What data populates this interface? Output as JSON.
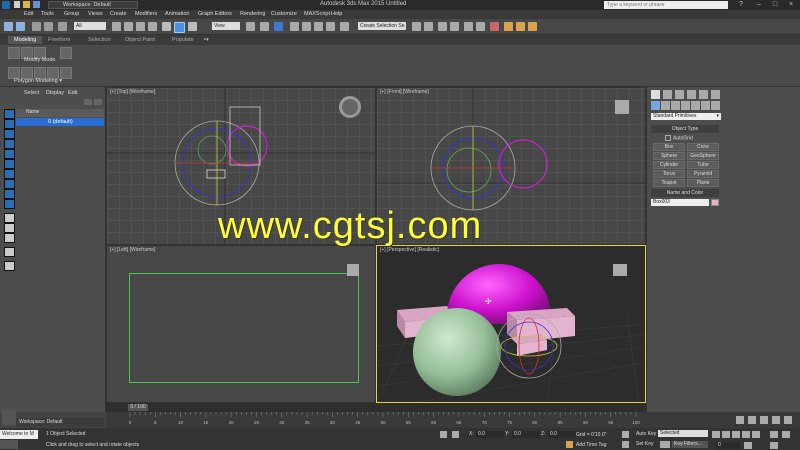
{
  "titlebar": {
    "workspace": "Workspace: Default",
    "title": "Autodesk 3ds Max 2015    Untitled",
    "search_placeholder": "Type a keyword or phrase"
  },
  "menu": [
    "Edit",
    "Tools",
    "Group",
    "Views",
    "Create",
    "Modifiers",
    "Animation",
    "Graph Editors",
    "Rendering",
    "Customize",
    "MAXScript",
    "Help"
  ],
  "toolbar": {
    "filter": "All",
    "view": "View",
    "selection_set": "Create Selection Se"
  },
  "ribbon": {
    "tabs": [
      "Modeling",
      "Freeform",
      "Selection",
      "Object Paint",
      "Populate"
    ],
    "modify_mode": "Modify Mode",
    "polygon_modeling": "Polygon Modeling"
  },
  "scene_explorer": {
    "tabs": [
      "Select",
      "Display",
      "Edit"
    ],
    "column": "Name",
    "rows": [
      "0 (default)"
    ],
    "workspace": "Workspace: Default"
  },
  "viewports": {
    "top": "[+] [Top] [Wireframe]",
    "front": "[+] [Front] [Wireframe]",
    "left": "[+] [Left] [Wireframe]",
    "perspective": "[+] [Perspective] [Realistic]"
  },
  "watermark": "www.cgtsj.com",
  "command_panel": {
    "category": "Standard Primitives",
    "object_type_header": "Object Type",
    "autogrid": "AutoGrid",
    "buttons": [
      "Box",
      "Cone",
      "Sphere",
      "GeoSphere",
      "Cylinder",
      "Tube",
      "Torus",
      "Pyramid",
      "Teapot",
      "Plane"
    ],
    "name_color_header": "Name and Color",
    "object_name": "Box003",
    "object_color": "#e8b0c8"
  },
  "timeline": {
    "slider": "0 / 100",
    "ticks": [
      "0",
      "5",
      "10",
      "15",
      "20",
      "25",
      "30",
      "35",
      "40",
      "45",
      "50",
      "55",
      "60",
      "65",
      "70",
      "75",
      "80",
      "85",
      "90",
      "95",
      "100"
    ]
  },
  "status": {
    "maxscript": "Welcome to M",
    "selected": "1 Object Selected",
    "prompt": "Click and drag to select and rotate objects",
    "x_label": "X:",
    "x": "0.0",
    "y_label": "Y:",
    "y": "0.0",
    "z_label": "Z:",
    "z": "0.0",
    "grid": "Grid = 0'10.0\"",
    "add_time_tag": "Add Time Tag",
    "auto_key": "Auto Key",
    "set_key": "Set Key",
    "key_mode": "Selected",
    "key_filters": "Key Filters...",
    "frame": "0"
  },
  "colors": {
    "accent": "#2b6cd0",
    "sphere_magenta": "#cc22cc",
    "sphere_green": "#9cc4a0",
    "box_pink": "#e0b0cc",
    "viewport_bg": "#474747",
    "active_border": "#e8d040",
    "watermark": "#ffff33"
  }
}
